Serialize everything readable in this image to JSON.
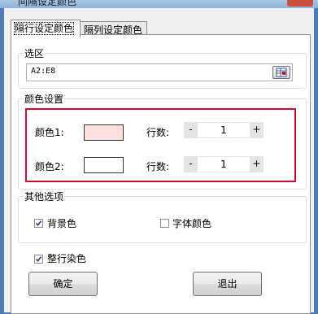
{
  "window": {
    "title": "间隔设定颜色"
  },
  "tabs": [
    {
      "label": "隔行设定颜色",
      "active": true
    },
    {
      "label": "隔列设定颜色",
      "active": false
    }
  ],
  "selection": {
    "group_label": "选区",
    "range": "A2:E8"
  },
  "color_settings": {
    "group_label": "颜色设置",
    "rows": [
      {
        "color_label": "颜色1:",
        "swatch_color": "#ffdede",
        "count_label": "行数:",
        "minus": "-",
        "plus": "+",
        "value": "1"
      },
      {
        "color_label": "颜色2:",
        "swatch_color": "#ffffff",
        "count_label": "行数:",
        "minus": "-",
        "plus": "+",
        "value": "1"
      }
    ]
  },
  "other_options": {
    "group_label": "其他选项",
    "background_color": {
      "label": "背景色",
      "checked": true
    },
    "font_color": {
      "label": "字体颜色",
      "checked": false
    }
  },
  "whole_row": {
    "label": "整行染色",
    "checked": true
  },
  "buttons": {
    "ok": "确定",
    "exit": "退出"
  },
  "colors": {
    "highlight_border": "#c8102e",
    "window_frame": "#4d7db3"
  }
}
